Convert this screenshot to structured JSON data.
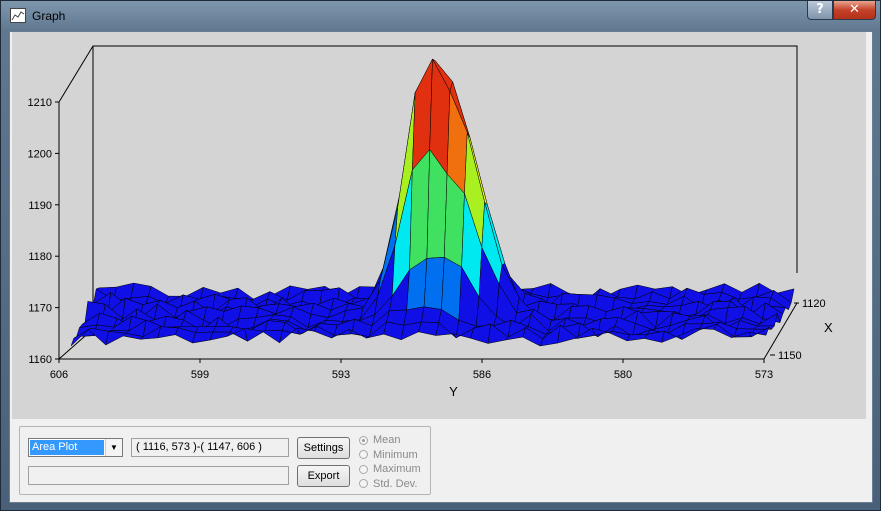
{
  "window": {
    "title": "Graph",
    "icon": "graph-icon"
  },
  "titlebar": {
    "help_label": "?",
    "close_label": "✕"
  },
  "chart_data": {
    "type": "surface",
    "zlabel_ticks": [
      "1210",
      "1200",
      "1190",
      "1180",
      "1170",
      "1160"
    ],
    "y_ticks": [
      "606",
      "599",
      "593",
      "586",
      "580",
      "573"
    ],
    "ylabel": "Y",
    "x_ticks": [
      "1120",
      "1150"
    ],
    "xlabel": "X",
    "zlim": [
      1160,
      1210
    ],
    "ylim": [
      606,
      573
    ],
    "xlim": [
      1120,
      1150
    ],
    "baseline_level": 1170,
    "peak": {
      "y": 590,
      "z": 1212
    },
    "secondary_peak": {
      "y": 588,
      "z": 1207
    },
    "colormap": [
      "#1010e6",
      "#0070f0",
      "#00e8f0",
      "#40e060",
      "#a8f020",
      "#f0f020",
      "#f07010",
      "#e03010"
    ]
  },
  "controls": {
    "plot_type_options_selected": "Area Plot",
    "range_text": "( 1116, 573 )-( 1147, 606 )",
    "status_text": "",
    "settings_label": "Settings",
    "export_label": "Export",
    "statistic_options": [
      "Mean",
      "Minimum",
      "Maximum",
      "Std. Dev."
    ],
    "statistic_selected": "Mean"
  }
}
